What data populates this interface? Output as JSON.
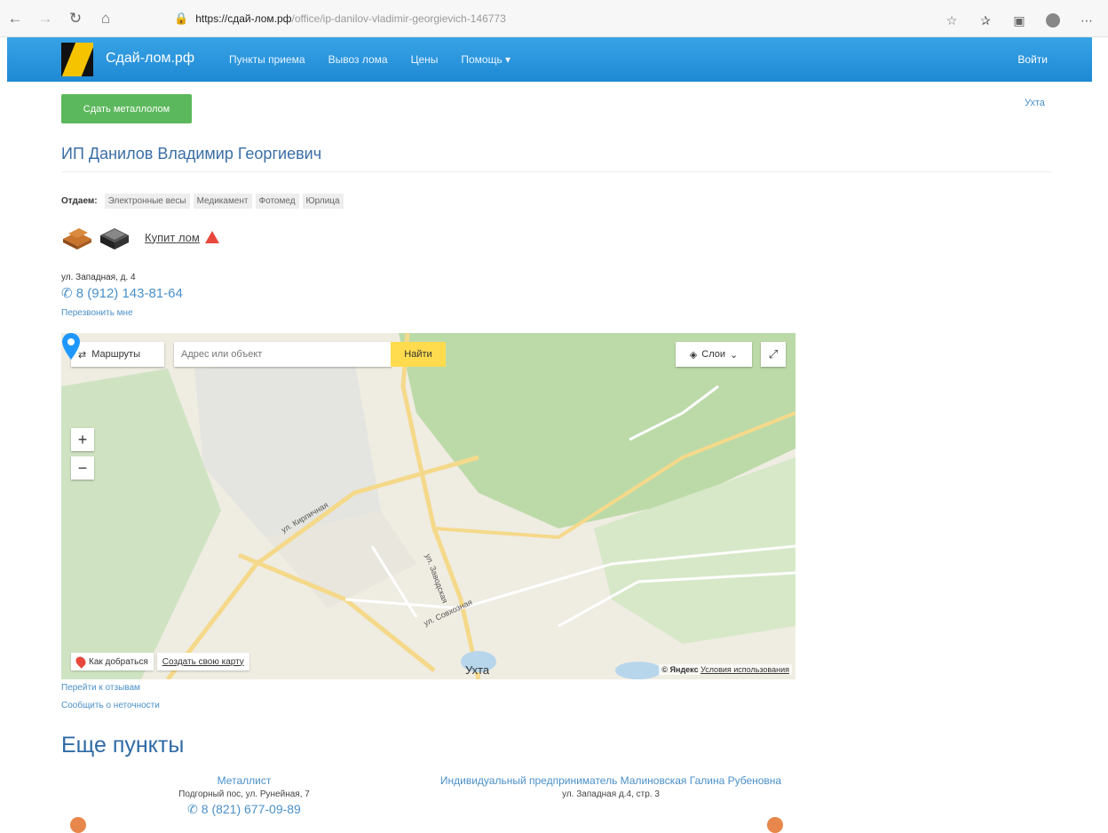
{
  "browser": {
    "url_host": "https://сдай-лом.рф",
    "url_path": "/office/ip-danilov-vladimir-georgievich-146773"
  },
  "site_nav": {
    "brand": "Сдай-лом.рф",
    "links": [
      "Пункты приема",
      "Вывоз лома",
      "Цены",
      "Помощь ▾"
    ],
    "login": "Войти"
  },
  "actions": {
    "sell_button": "Сдать металлолом",
    "city": "Ухта"
  },
  "company": {
    "title": "ИП Данилов Владимир Георгиевич",
    "accepts_label": "Отдаем:",
    "accepts_tags": [
      "Электронные весы",
      "Медикамент",
      "Фотомед",
      "Юрлица"
    ],
    "buy_link": "Купит лом",
    "address": "ул. Западная, д. 4",
    "phone": "8 (912) 143-81-64",
    "callback": "Перезвонить мне"
  },
  "map": {
    "routes_label": "Маршруты",
    "search_placeholder": "Адрес или объект",
    "find_label": "Найти",
    "layers_label": "Слои",
    "zoom_in": "+",
    "zoom_out": "−",
    "how_to_get": "Как добраться",
    "create_map": "Создать свою карту",
    "city_label": "Ухта",
    "copyright": "© Яндекс",
    "terms": "Условия использования",
    "streets": [
      "ул. Кирпичная",
      "ул. Заводская",
      "ул. Совхозная"
    ]
  },
  "under_map": {
    "reviews": "Перейти к отзывам",
    "report": "Сообщить о неточности"
  },
  "more": {
    "title": "Еще пункты",
    "cards": [
      {
        "name": "Металлист",
        "address": "Подгорный пос, ул. Рунейная, 7",
        "phone": "8 (821) 677-09-89"
      },
      {
        "name": "Индивидуальный предприниматель Малиновская Галина Рубеновна",
        "address": "ул. Западная д.4, стр. 3",
        "phone": ""
      }
    ]
  }
}
